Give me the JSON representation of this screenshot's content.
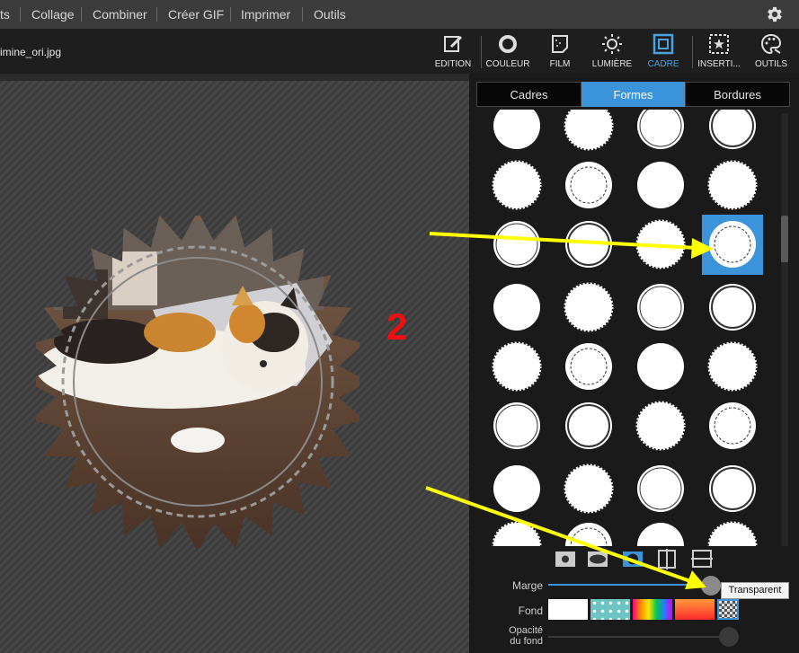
{
  "menu": {
    "items": [
      {
        "key": "ts",
        "label": "ts"
      },
      {
        "key": "collage",
        "label": "Collage"
      },
      {
        "key": "combiner",
        "label": "Combiner"
      },
      {
        "key": "gif",
        "label": "Créer GIF"
      },
      {
        "key": "imprimer",
        "label": "Imprimer"
      },
      {
        "key": "outils",
        "label": "Outils"
      }
    ],
    "settings_icon": "gear-icon"
  },
  "file": {
    "name": "imine_ori.jpg"
  },
  "toolbar": {
    "tools": [
      {
        "key": "edition",
        "label": "EDITION",
        "icon": "edit-icon"
      },
      {
        "key": "couleur",
        "label": "COULEUR",
        "icon": "color-ring-icon"
      },
      {
        "key": "film",
        "label": "FILM",
        "icon": "film-icon"
      },
      {
        "key": "lumiere",
        "label": "LUMIÈRE",
        "icon": "sun-icon"
      },
      {
        "key": "cadre",
        "label": "CADRE",
        "icon": "frame-icon",
        "active": true
      },
      {
        "key": "insertion",
        "label": "INSERTI...",
        "icon": "insert-star-icon"
      },
      {
        "key": "outils",
        "label": "OUTILS",
        "icon": "palette-icon"
      }
    ],
    "accent_color": "#4aa3df"
  },
  "tabs": [
    {
      "key": "cadres",
      "label": "Cadres"
    },
    {
      "key": "formes",
      "label": "Formes",
      "active": true
    },
    {
      "key": "bordures",
      "label": "Bordures"
    }
  ],
  "shapes": {
    "selected_index": 11,
    "highlight_color": "#3b94d9"
  },
  "controls": {
    "marge_label": "Marge",
    "fond_label": "Fond",
    "opacite_label_line1": "Opacité",
    "opacite_label_line2": "du fond",
    "tooltip": "Transparent",
    "swatches": [
      "white",
      "teal-dots",
      "rainbow",
      "orange-red-gradient",
      "transparent-checker"
    ]
  },
  "annotation": {
    "number": "2",
    "color": "#f01010",
    "arrow_color": "#ffff00"
  }
}
